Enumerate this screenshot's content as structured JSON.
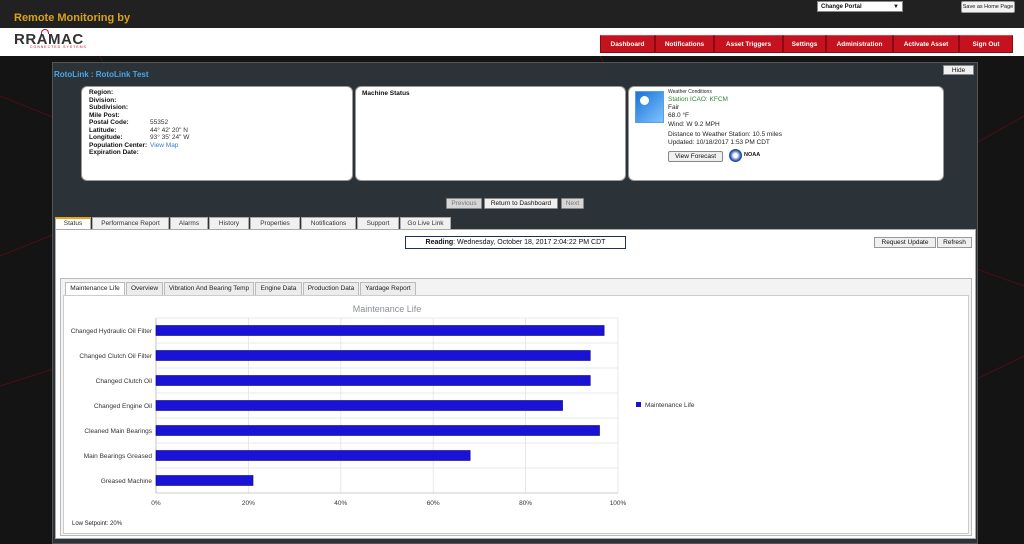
{
  "app": {
    "title": "Remote Monitoring by"
  },
  "portal": {
    "selected": "Change Portal"
  },
  "save_home": "Save as Home Page",
  "logo": {
    "text": "RRAMAC",
    "tagline": "CONNECTED SYSTEMS"
  },
  "nav": [
    "Dashboard",
    "Notifications",
    "Asset Triggers",
    "Settings",
    "Administration",
    "Activate Asset",
    "Sign Out"
  ],
  "hide_label": "Hide",
  "heading": "RotoLink : RotoLink Test",
  "info": [
    {
      "label": "Region:",
      "value": ""
    },
    {
      "label": "Division:",
      "value": ""
    },
    {
      "label": "Subdivision:",
      "value": ""
    },
    {
      "label": "Mile Post:",
      "value": ""
    },
    {
      "label": "Postal Code:",
      "value": "55352"
    },
    {
      "label": "Latitude:",
      "value": "44° 42' 20\" N"
    },
    {
      "label": "Longitude:",
      "value": "93° 35' 24\" W"
    },
    {
      "label": "Population Center:",
      "value": "View Map"
    },
    {
      "label": "Expiration Date:",
      "value": ""
    }
  ],
  "machine_status": {
    "title": "Machine Status"
  },
  "weather": {
    "title": "Weather Conditions",
    "station": "Station ICAO: KFCM",
    "condition": "Fair",
    "temp": "68.0 °F",
    "wind": "Wind: W 9.2 MPH",
    "distance": "Distance to Weather Station: 10.5 miles",
    "updated": "Updated: 10/18/2017 1:53 PM CDT",
    "forecast_btn": "View Forecast",
    "noaa": "NOAA"
  },
  "pager": {
    "previous": "Previous",
    "return": "Return to Dashboard",
    "next": "Next"
  },
  "tabs": [
    "Status",
    "Performance Report",
    "Alarms",
    "History",
    "Properties",
    "Notifications",
    "Support",
    "Go Live Link"
  ],
  "reading": {
    "label": "Reading",
    "value": ": Wednesday, October 18, 2017 2:04:22 PM CDT"
  },
  "buttons": {
    "request_update": "Request Update",
    "refresh": "Refresh"
  },
  "subtabs": [
    "Maintenance Life",
    "Overview",
    "Vibration And Bearing Temp",
    "Engine Data",
    "Production Data",
    "Yardage Report"
  ],
  "setpoint": "Low Setpoint: 20%",
  "colors": {
    "nav_red": "#c4121f",
    "bar_blue": "#1a12d6",
    "title_gold": "#d9a21a",
    "heading_blue": "#49a8e8"
  },
  "chart_data": {
    "type": "bar",
    "orientation": "horizontal",
    "title": "Maintenance Life",
    "categories": [
      "Changed Hydraulic Oil Filter",
      "Changed Clutch Oil Filter",
      "Changed Clutch Oil",
      "Changed Engine Oil",
      "Cleaned Main Bearings",
      "Main Bearings Greased",
      "Greased Machine"
    ],
    "series": [
      {
        "name": "Maintenance Life",
        "values": [
          97,
          94,
          94,
          88,
          96,
          68,
          21
        ]
      }
    ],
    "xlim": [
      0,
      100
    ],
    "xticks": [
      "0%",
      "20%",
      "40%",
      "60%",
      "80%",
      "100%"
    ],
    "grid": true,
    "legend": "right"
  }
}
